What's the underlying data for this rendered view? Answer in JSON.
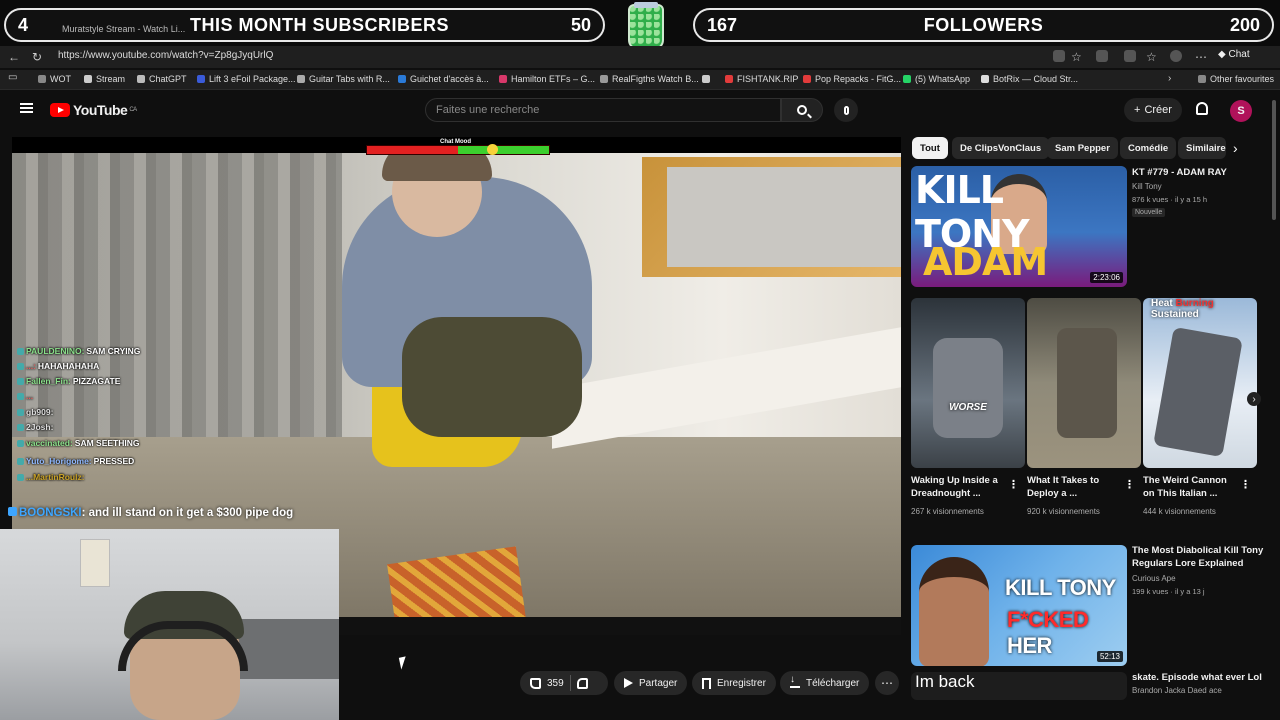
{
  "overlay": {
    "subs_count": "4",
    "subs_label": "THIS MONTH SUBSCRIBERS",
    "subs_goal": "50",
    "followers_count": "167",
    "followers_label": "FOLLOWERS",
    "followers_goal": "200"
  },
  "browser": {
    "tab_title": "Muratstyle Stream - Watch Li...",
    "url": "https://www.youtube.com/watch?v=Zp8gJyqUrlQ",
    "chat_button": "Chat",
    "bookmarks": [
      {
        "label": "WOT",
        "color": "#888888"
      },
      {
        "label": "Stream",
        "color": "#cccccc"
      },
      {
        "label": "ChatGPT",
        "color": "#bbbbbb"
      },
      {
        "label": "Lift 3 eFoil Package...",
        "color": "#3a5bd9"
      },
      {
        "label": "Guitar Tabs with R...",
        "color": "#aaaaaa"
      },
      {
        "label": "Guichet d'accès à...",
        "color": "#2a7ad8"
      },
      {
        "label": "Hamilton ETFs – G...",
        "color": "#d8386a"
      },
      {
        "label": "RealFigths Watch B...",
        "color": "#999999"
      },
      {
        "label": "",
        "color": "#cccccc"
      },
      {
        "label": "FISHTANK.RIP",
        "color": "#e23b3b"
      },
      {
        "label": "Pop Repacks - FitG...",
        "color": "#e23b3b"
      },
      {
        "label": "(5) WhatsApp",
        "color": "#25d366"
      },
      {
        "label": "BotRix — Cloud Str...",
        "color": "#dddddd"
      }
    ],
    "other_favourites": "Other favourites"
  },
  "youtube": {
    "logo": "YouTube",
    "region": "CA",
    "search_placeholder": "Faites une recherche",
    "create_label": "Créer",
    "avatar_letter": "S"
  },
  "video": {
    "chat_mood_label": "Chat Mood",
    "mood_positive_fraction": 0.5,
    "likes": "359",
    "share_label": "Partager",
    "save_label": "Enregistrer",
    "download_label": "Télécharger"
  },
  "stream_chat": [
    {
      "user": "PAULDENINO:",
      "msg": "SAM CRYING",
      "color": "#8be08b"
    },
    {
      "user": "...:",
      "msg": "HAHAHAHAHA",
      "color": "#e05b5b"
    },
    {
      "user": "Fallen_Fin:",
      "msg": "PIZZAGATE",
      "color": "#8be08b"
    },
    {
      "user": "...",
      "msg": "",
      "color": "#e05b5b"
    },
    {
      "user": "gb909:",
      "msg": "",
      "color": "#dddddd"
    },
    {
      "user": "2Josh:",
      "msg": "",
      "color": "#dddddd"
    },
    {
      "user": "vaccinated:",
      "msg": "SAM SEETHING",
      "color": "#8be08b"
    },
    {
      "user": "Yuto_Horigome:",
      "msg": "PRESSED",
      "color": "#8fb8ff"
    },
    {
      "user": "...MartinRoulz:",
      "msg": "",
      "color": "#c9a227"
    }
  ],
  "highlight_message": {
    "user": "BOONGSKI",
    "msg": ": and ill stand on it get a $300 pipe dog"
  },
  "chips": [
    "Tout",
    "De ClipsVonClaus",
    "Sam Pepper",
    "Comédie",
    "Similaire"
  ],
  "featured": {
    "thumb_line1": "KILL TONY",
    "thumb_line2": "ADAM RAY",
    "duration": "2:23:06",
    "title": "KT #779 - ADAM RAY",
    "channel": "Kill Tony",
    "meta": "876 k vues · il y a 15 h",
    "badge": "Nouvelle"
  },
  "shorts": [
    {
      "title": "Waking Up Inside a Dreadnought ...",
      "views": "267 k visionnements",
      "overlay": "WORSE"
    },
    {
      "title": "What It Takes to Deploy a ...",
      "views": "920 k visionnements",
      "overlay": ""
    },
    {
      "title": "The Weird Cannon on This Italian ...",
      "views": "444 k visionnements",
      "overlay_a": "Heat",
      "overlay_b": "Sustained"
    }
  ],
  "second": {
    "thumb_line1": "KILL TONY",
    "thumb_line2a": "F*CKED",
    "thumb_line2b": "HER",
    "duration": "52:13",
    "title": "The Most Diabolical Kill Tony Regulars Lore Explained",
    "channel": "Curious Ape",
    "meta": "199 k vues · il y a 13 j"
  },
  "third": {
    "thumb_text": "Im back",
    "title": "skate. Episode what ever Lol",
    "channel": "Brandon Jacka Daed ace"
  }
}
